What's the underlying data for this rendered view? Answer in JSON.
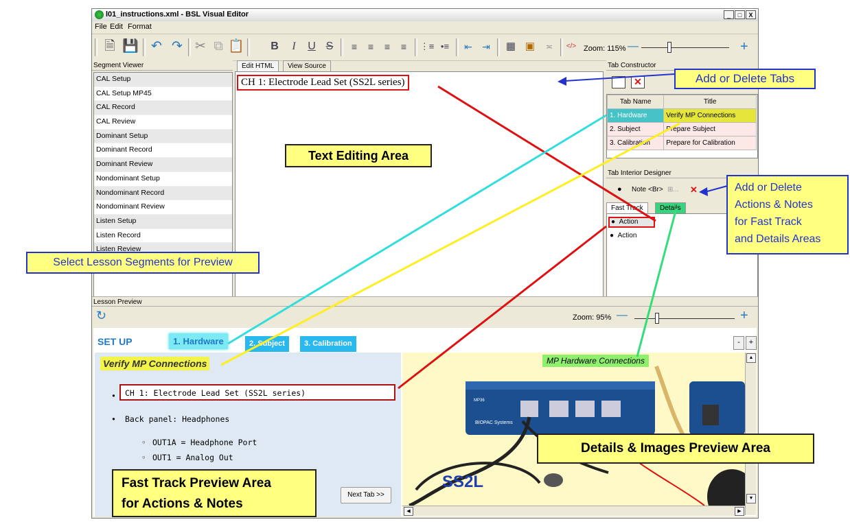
{
  "window": {
    "title": "l01_instructions.xml - BSL Visual Editor",
    "min": "_",
    "max": "□",
    "close": "X"
  },
  "menu": [
    "File",
    "Edit",
    "Format"
  ],
  "toolbar": {
    "zoom_label": "Zoom: 115%",
    "zoom_level_percent": 115,
    "bold": "B",
    "italic": "I",
    "underline": "U",
    "strike": "S"
  },
  "segment_viewer": {
    "header": "Segment Viewer",
    "items": [
      "CAL Setup",
      "CAL Setup MP45",
      "CAL Record",
      "CAL Review",
      "Dominant Setup",
      "Dominant Record",
      "Dominant Review",
      "Nondominant Setup",
      "Nondominant Record",
      "Nondominant Review",
      "Listen Setup",
      "Listen Record",
      "Listen Review"
    ]
  },
  "editor": {
    "tabs": [
      "Edit HTML",
      "View Source"
    ],
    "content": "CH 1: Electrode Lead Set (SS2L series)"
  },
  "tab_constructor": {
    "header": "Tab Constructor",
    "columns": [
      "Tab Name",
      "Title"
    ],
    "rows": [
      {
        "name": "1. Hardware",
        "title": "Verify MP Connections"
      },
      {
        "name": "2. Subject",
        "title": "Prepare Subject"
      },
      {
        "name": "3. Calibration",
        "title": "Prepare for Calibration"
      }
    ]
  },
  "tab_interior": {
    "header": "Tab Interior Designer",
    "note_label": "Note",
    "br_label": "<Br>",
    "dots_label": "⊞...",
    "tabs": [
      "Fast Track",
      "Details"
    ],
    "actions": [
      "Action",
      "Action"
    ]
  },
  "preview": {
    "header": "Lesson Preview",
    "zoom_label": "Zoom: 95%",
    "zoom_level_percent": 95,
    "setup_label": "SET UP",
    "tabs": [
      "1. Hardware",
      "2. Subject",
      "3. Calibration"
    ],
    "minus": "-",
    "plus": "+",
    "heading": "Verify MP Connections",
    "bullets": [
      "CH 1: Electrode Lead Set (SS2L series)",
      "Back panel: Headphones"
    ],
    "sub_bullets": [
      "OUT1A = Headphone Port",
      "OUT1 = Analog Out"
    ],
    "next_tab": "Next Tab >>",
    "image_caption": "MP Hardware Connections",
    "device_label": "MP36",
    "brand_label": "BIOPAC Systems",
    "product_label": "SS2L"
  },
  "callouts": {
    "add_delete_tabs": "Add or Delete Tabs",
    "text_editing_area": "Text Editing Area",
    "add_delete_actions_1": "Add or Delete",
    "add_delete_actions_2": "Actions & Notes",
    "add_delete_actions_3": "for Fast Track",
    "add_delete_actions_4": "and Details Areas",
    "select_segments": "Select Lesson Segments for Preview",
    "details_preview": "Details & Images Preview Area",
    "fast_track_1": "Fast Track Preview Area",
    "fast_track_2": "for Actions & Notes"
  },
  "colors": {
    "red": "#dd1111",
    "cyan": "#33dddd",
    "yellow": "#ffee22",
    "green": "#33dd77",
    "blue": "#2233cc",
    "tab_blue": "#29b9ee"
  }
}
